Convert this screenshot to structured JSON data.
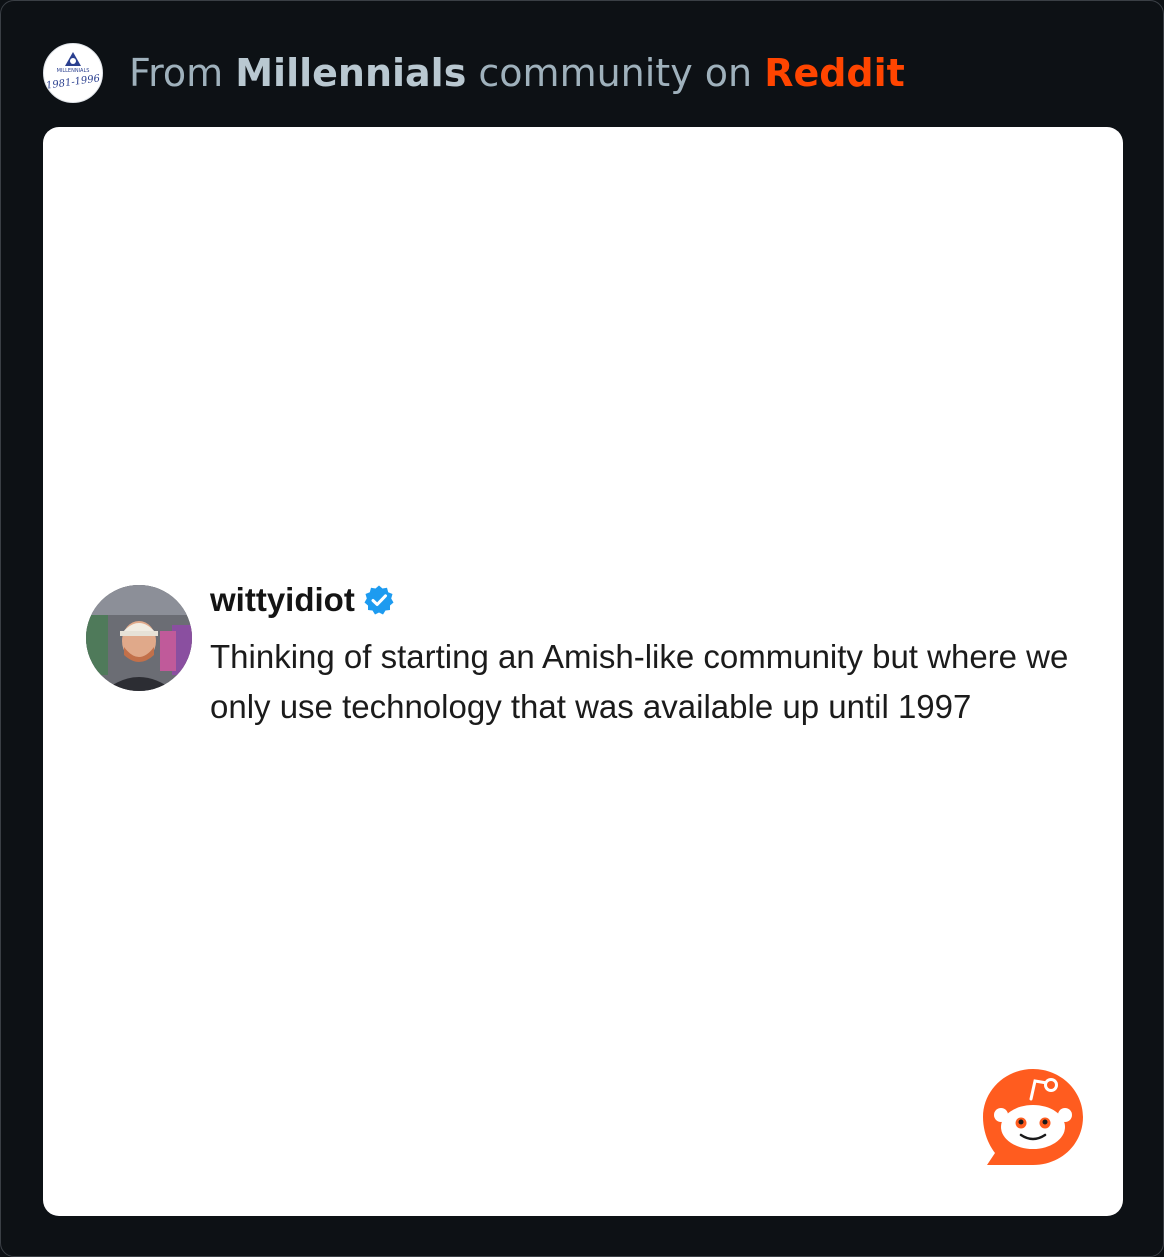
{
  "header": {
    "prefix": "From ",
    "community": "Millennials",
    "middle": " community on ",
    "platform": "Reddit",
    "platform_color": "#ff4500"
  },
  "community_avatar": {
    "icon": "millennials-logo-icon",
    "caption_top": "MILLENNIALS",
    "caption_years": "1981-1996"
  },
  "post": {
    "username": "wittyidiot",
    "verified_icon": "verified-badge-icon",
    "verified_color": "#1d9bf0",
    "text": "Thinking of starting an Amish-like community but where we only use technology that was available up until 1997"
  },
  "watermark": {
    "icon": "reddit-snoo-icon",
    "color": "#ff5c1f"
  }
}
